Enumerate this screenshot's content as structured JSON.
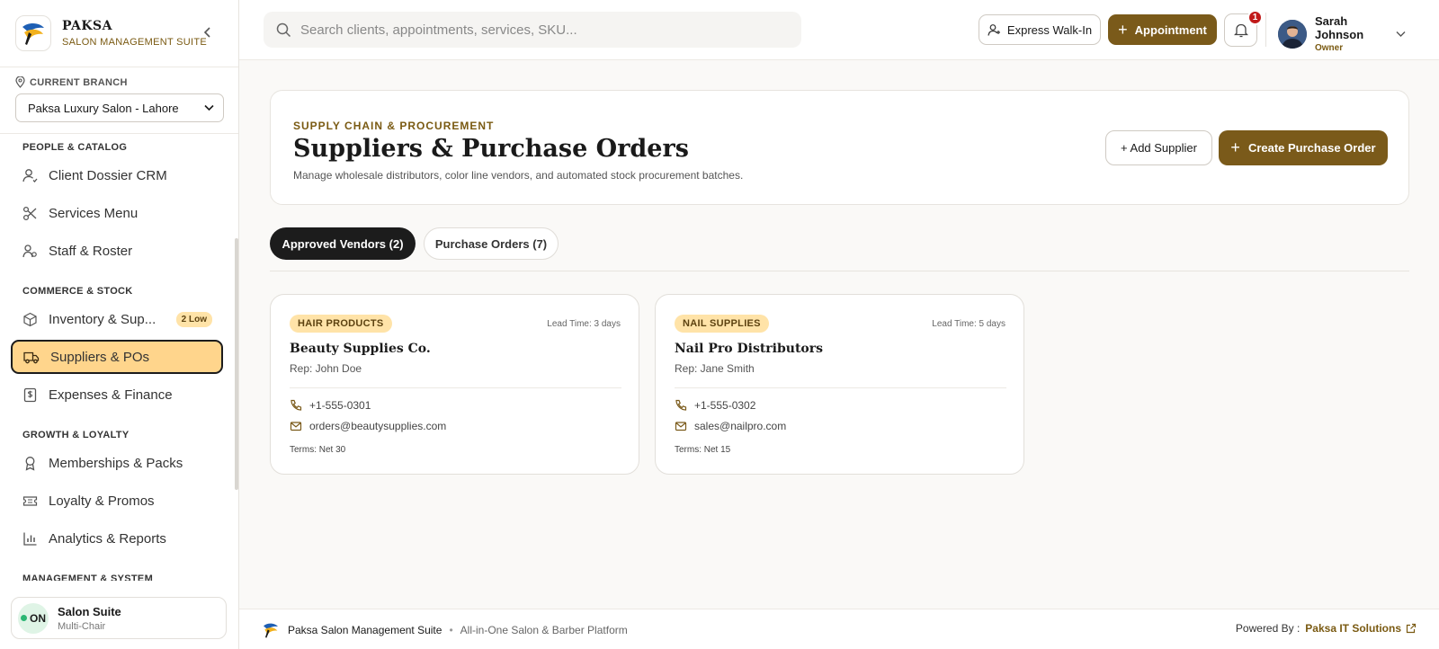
{
  "brand": {
    "name": "PAKSA",
    "subtitle": "SALON MANAGEMENT SUITE"
  },
  "branch": {
    "label": "CURRENT BRANCH",
    "selected": "Paksa Luxury Salon - Lahore"
  },
  "nav": {
    "sections": [
      {
        "title": "PEOPLE & CATALOG",
        "items": [
          {
            "label": "Client Dossier CRM",
            "icon": "user-icon"
          },
          {
            "label": "Services Menu",
            "icon": "scissors-icon"
          },
          {
            "label": "Staff & Roster",
            "icon": "staff-icon"
          }
        ]
      },
      {
        "title": "COMMERCE & STOCK",
        "items": [
          {
            "label": "Inventory & Sup...",
            "icon": "box-icon",
            "badge": "2 Low"
          },
          {
            "label": "Suppliers & POs",
            "icon": "truck-icon",
            "active": true
          },
          {
            "label": "Expenses & Finance",
            "icon": "receipt-icon"
          }
        ]
      },
      {
        "title": "GROWTH & LOYALTY",
        "items": [
          {
            "label": "Memberships & Packs",
            "icon": "award-icon"
          },
          {
            "label": "Loyalty & Promos",
            "icon": "ticket-icon"
          },
          {
            "label": "Analytics & Reports",
            "icon": "bar-chart-icon"
          }
        ]
      },
      {
        "title": "MANAGEMENT & SYSTEM",
        "items": []
      }
    ]
  },
  "suite": {
    "status": "ON",
    "title": "Salon Suite",
    "subtitle": "Multi-Chair"
  },
  "topbar": {
    "search_placeholder": "Search clients, appointments, services, SKU...",
    "walkin_label": "Express Walk-In",
    "appointment_label": "Appointment",
    "notification_count": "1",
    "user": {
      "name": "Sarah Johnson",
      "role": "Owner"
    }
  },
  "header": {
    "eyebrow": "SUPPLY CHAIN & PROCUREMENT",
    "title": "Suppliers & Purchase Orders",
    "description": "Manage wholesale distributors, color line vendors, and automated stock procurement batches.",
    "add_supplier_label": "+ Add Supplier",
    "create_po_label": "Create Purchase Order"
  },
  "tabs": [
    {
      "label": "Approved Vendors (2)",
      "active": true
    },
    {
      "label": "Purchase Orders (7)",
      "active": false
    }
  ],
  "vendors": [
    {
      "category": "HAIR PRODUCTS",
      "lead_time": "Lead Time: 3 days",
      "name": "Beauty Supplies Co.",
      "rep": "Rep: John Doe",
      "phone": "+1-555-0301",
      "email": "orders@beautysupplies.com",
      "terms": "Terms: Net 30"
    },
    {
      "category": "NAIL SUPPLIES",
      "lead_time": "Lead Time: 5 days",
      "name": "Nail Pro Distributors",
      "rep": "Rep: Jane Smith",
      "phone": "+1-555-0302",
      "email": "sales@nailpro.com",
      "terms": "Terms: Net 15"
    }
  ],
  "footer": {
    "app_name": "Paksa Salon Management Suite",
    "separator": "•",
    "tagline": "All-in-One Salon & Barber Platform",
    "powered_label": "Powered By :",
    "company": "Paksa IT Solutions"
  },
  "colors": {
    "accent": "#7a5a1a",
    "active_nav": "#ffd58c",
    "badge": "#ffe3a8",
    "dark": "#1c1c1c"
  }
}
